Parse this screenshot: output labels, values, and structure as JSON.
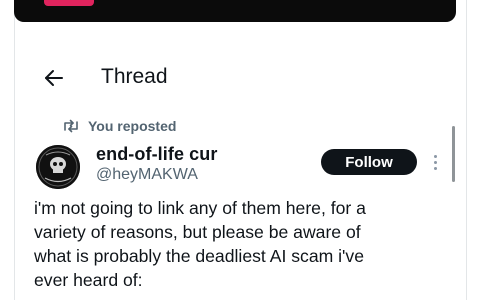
{
  "header": {
    "title": "Thread",
    "back_icon": "arrow-left-icon"
  },
  "repost": {
    "icon": "repost-icon",
    "label": "You reposted"
  },
  "author": {
    "name": "end-of-life cur",
    "handle": "@heyMAKWA",
    "avatar_icon": "avatar-image"
  },
  "actions": {
    "follow_label": "Follow",
    "more_icon": "more-vertical-icon"
  },
  "tweet": {
    "lines": [
      "i'm not going to link any of them here, for a",
      "variety of reasons, but please be aware of",
      "what is probably the deadliest AI scam i've",
      "ever heard of:"
    ]
  },
  "colors": {
    "text_primary": "#0f1419",
    "text_secondary": "#536471",
    "follow_bg": "#0f1419",
    "follow_text": "#ffffff",
    "top_badge": "#e0245e"
  }
}
